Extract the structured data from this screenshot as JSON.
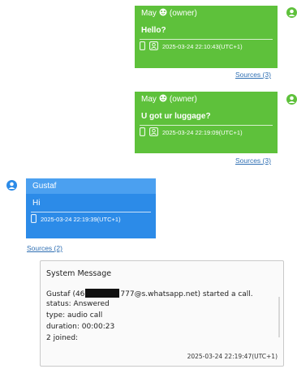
{
  "messages": [
    {
      "sender": "May",
      "role": "(owner)",
      "text": "Hello?",
      "timestamp": "2025-03-24 22:10:43(UTC+1)",
      "sources": "Sources (3)"
    },
    {
      "sender": "May",
      "role": "(owner)",
      "text": "U got ur luggage?",
      "timestamp": "2025-03-24 22:19:09(UTC+1)",
      "sources": "Sources (3)"
    },
    {
      "sender": "Gustaf",
      "text": "Hi",
      "timestamp": "2025-03-24 22:19:39(UTC+1)",
      "sources": "Sources (2)"
    }
  ],
  "system_message": {
    "title": "System Message",
    "caller_prefix": "Gustaf (46",
    "caller_suffix": "777@s.whatsapp.net) started a call.",
    "status": "status: Answered",
    "type": "type: audio call",
    "duration": "duration: 00:00:23",
    "joined": "2 joined:",
    "timestamp": "2025-03-24 22:19:47(UTC+1)"
  },
  "colors": {
    "owner_bubble": "#5ec13b",
    "contact_bubble": "#2c8be8",
    "link": "#2f6fb3"
  },
  "icons": [
    "user-avatar-icon",
    "sticker-emoji-icon",
    "phone-icon",
    "contacts-icon"
  ]
}
